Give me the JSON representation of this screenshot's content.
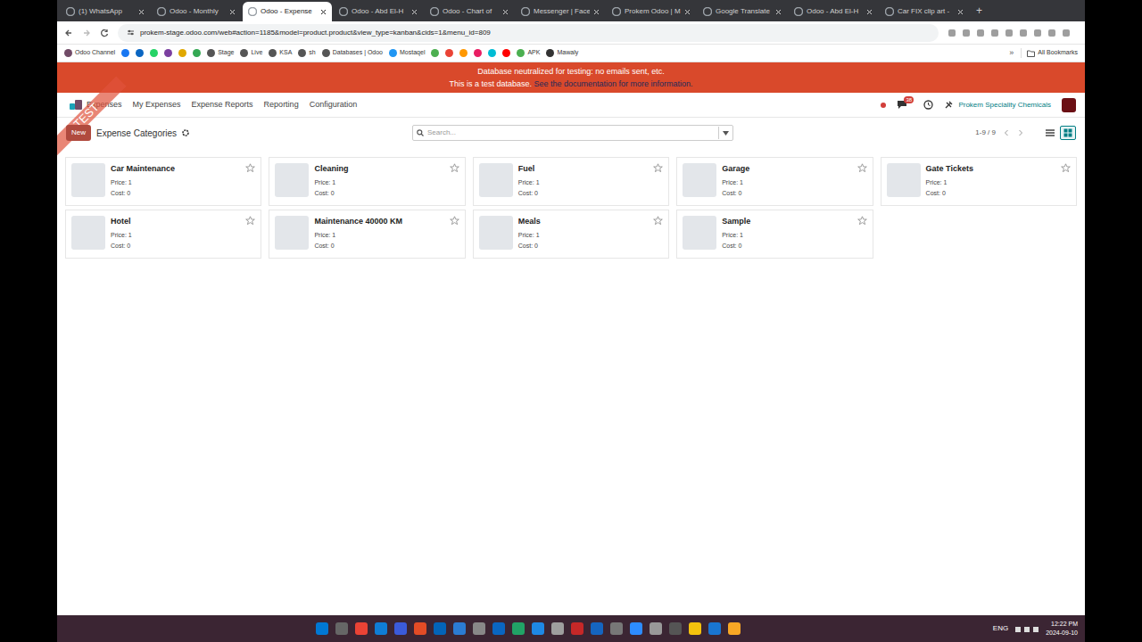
{
  "browser": {
    "tabs": [
      {
        "label": "(1) WhatsApp",
        "selected": false
      },
      {
        "label": "Odoo - Monthly",
        "selected": false
      },
      {
        "label": "Odoo - Expense",
        "selected": true
      },
      {
        "label": "Odoo - Abd El-H",
        "selected": false
      },
      {
        "label": "Odoo - Chart of",
        "selected": false
      },
      {
        "label": "Messenger | Face",
        "selected": false
      },
      {
        "label": "Prokem Odoo | M",
        "selected": false
      },
      {
        "label": "Google Translate",
        "selected": false
      },
      {
        "label": "Odoo - Abd El-H",
        "selected": false
      },
      {
        "label": "Car FIX clip art -",
        "selected": false
      }
    ],
    "new_tab": "+",
    "address": "prokem-stage.odoo.com/web#action=1185&model=product.product&view_type=kanban&cids=1&menu_id=809",
    "bookmarks": [
      {
        "kind": "text",
        "label": "Odoo Channel",
        "color": "#714b67"
      },
      {
        "kind": "icon",
        "label": "",
        "color": "#1877f2"
      },
      {
        "kind": "icon",
        "label": "",
        "color": "#0a66c2"
      },
      {
        "kind": "icon",
        "label": "",
        "color": "#25d366"
      },
      {
        "kind": "icon",
        "label": "",
        "color": "#7b3fa0"
      },
      {
        "kind": "icon",
        "label": "",
        "color": "#e0a800"
      },
      {
        "kind": "icon",
        "label": "",
        "color": "#34a853"
      },
      {
        "kind": "text",
        "label": "Stage",
        "color": "#555555"
      },
      {
        "kind": "text",
        "label": "Live",
        "color": "#555555"
      },
      {
        "kind": "text",
        "label": "KSA",
        "color": "#555555"
      },
      {
        "kind": "text",
        "label": "sh",
        "color": "#555555"
      },
      {
        "kind": "text",
        "label": "Databases | Odoo",
        "color": "#555555"
      },
      {
        "kind": "text",
        "label": "Mostaqel",
        "color": "#2196f3"
      },
      {
        "kind": "icon",
        "label": "",
        "color": "#4caf50"
      },
      {
        "kind": "icon",
        "label": "",
        "color": "#ea4335"
      },
      {
        "kind": "icon",
        "label": "",
        "color": "#ff9800"
      },
      {
        "kind": "icon",
        "label": "",
        "color": "#e91e63"
      },
      {
        "kind": "icon",
        "label": "",
        "color": "#00bcd4"
      },
      {
        "kind": "icon",
        "label": "",
        "color": "#ff0000"
      },
      {
        "kind": "text",
        "label": "APK",
        "color": "#4caf50"
      },
      {
        "kind": "text",
        "label": "Mawaly",
        "color": "#333333"
      }
    ],
    "more": "»",
    "all_bookmarks": "All Bookmarks"
  },
  "banner": {
    "line1": "Database neutralized for testing: no emails sent, etc.",
    "line2": "This is a test database.",
    "link": "See the documentation for more information."
  },
  "ribbon": "TEST",
  "navbar": {
    "app": "Expenses",
    "menu": [
      "My Expenses",
      "Expense Reports",
      "Reporting",
      "Configuration"
    ],
    "chat_count": "38",
    "company": "Prokem Speciality Chemicals"
  },
  "control": {
    "new": "New",
    "title": "Expense Categories",
    "search": {
      "placeholder": "Search..."
    },
    "pager": "1-9 / 9",
    "views": [
      {
        "name": "list",
        "selected": false
      },
      {
        "name": "kanban",
        "selected": true
      }
    ]
  },
  "cards": [
    {
      "name": "Car Maintenance",
      "price": "Price: 1",
      "cost": "Cost: 0",
      "starred": false
    },
    {
      "name": "Cleaning",
      "price": "Price: 1",
      "cost": "Cost: 0",
      "starred": false
    },
    {
      "name": "Fuel",
      "price": "Price: 1",
      "cost": "Cost: 0",
      "starred": false
    },
    {
      "name": "Garage",
      "price": "Price: 1",
      "cost": "Cost: 0",
      "starred": false
    },
    {
      "name": "Gate Tickets",
      "price": "Price: 1",
      "cost": "Cost: 0",
      "starred": false
    },
    {
      "name": "Hotel",
      "price": "Price: 1",
      "cost": "Cost: 0",
      "starred": false
    },
    {
      "name": "Maintenance 40000 KM",
      "price": "Price: 1",
      "cost": "Cost: 0",
      "starred": false
    },
    {
      "name": "Meals",
      "price": "Price: 1",
      "cost": "Cost: 0",
      "starred": false
    },
    {
      "name": "Sample",
      "price": "Price: 1",
      "cost": "Cost: 0",
      "starred": false
    }
  ],
  "taskbar": {
    "apps": [
      {
        "color": "#0078d4"
      },
      {
        "color": "#666666"
      },
      {
        "color": "#ea4335"
      },
      {
        "color": "#0f7dd6"
      },
      {
        "color": "#3b5bdb"
      },
      {
        "color": "#e34c26"
      },
      {
        "color": "#0364b8"
      },
      {
        "color": "#2b7cd3"
      },
      {
        "color": "#888888"
      },
      {
        "color": "#0a66c2"
      },
      {
        "color": "#21a366"
      },
      {
        "color": "#1e88e5"
      },
      {
        "color": "#9e9e9e"
      },
      {
        "color": "#c62828"
      },
      {
        "color": "#1565c0"
      },
      {
        "color": "#777777"
      },
      {
        "color": "#2d8cff"
      },
      {
        "color": "#999999"
      },
      {
        "color": "#555555"
      },
      {
        "color": "#f4c20d"
      },
      {
        "color": "#1976d2"
      },
      {
        "color": "#f9a825"
      }
    ],
    "lang": "ENG",
    "time": "12:22 PM",
    "date": "2024-09-10"
  }
}
